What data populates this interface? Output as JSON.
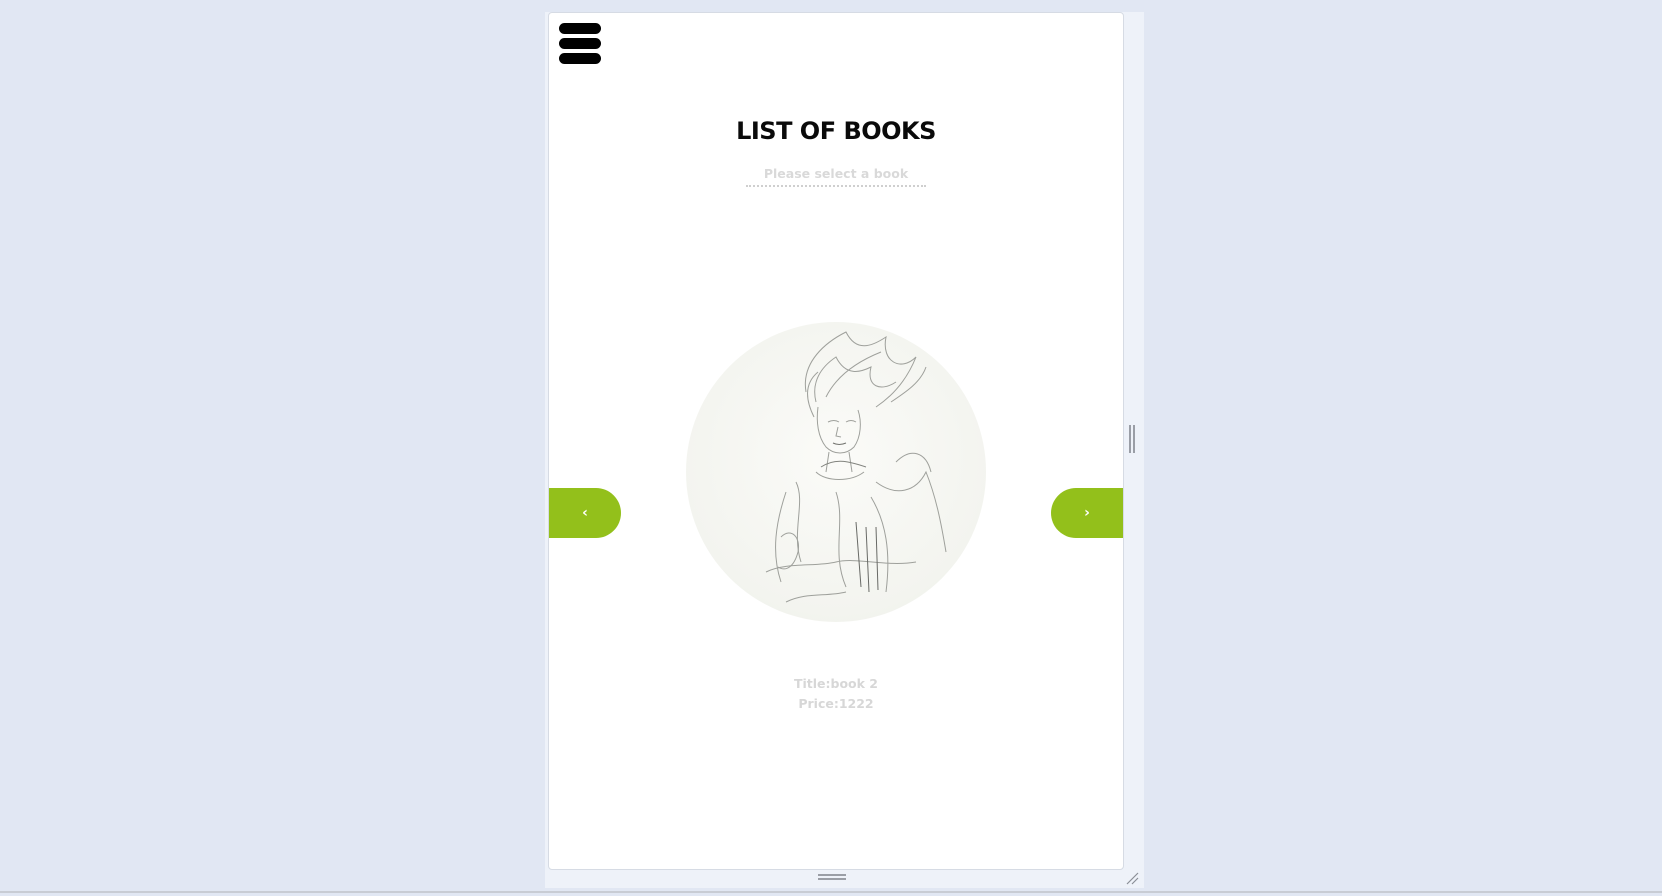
{
  "page": {
    "title": "LIST OF BOOKS",
    "subtitle": "Please select a book"
  },
  "carousel": {
    "prev_label": "‹",
    "next_label": "›",
    "current_book": {
      "title_text": "Title:book 2",
      "price_text": "Price:1222"
    }
  },
  "icons": {
    "menu": "hamburger-menu-icon",
    "cover": "pencil-sketch-portrait-image"
  },
  "colors": {
    "background": "#e1e7f3",
    "accent": "#93c01b",
    "title": "#0a0a0a",
    "muted_text": "#d7d7d7"
  }
}
